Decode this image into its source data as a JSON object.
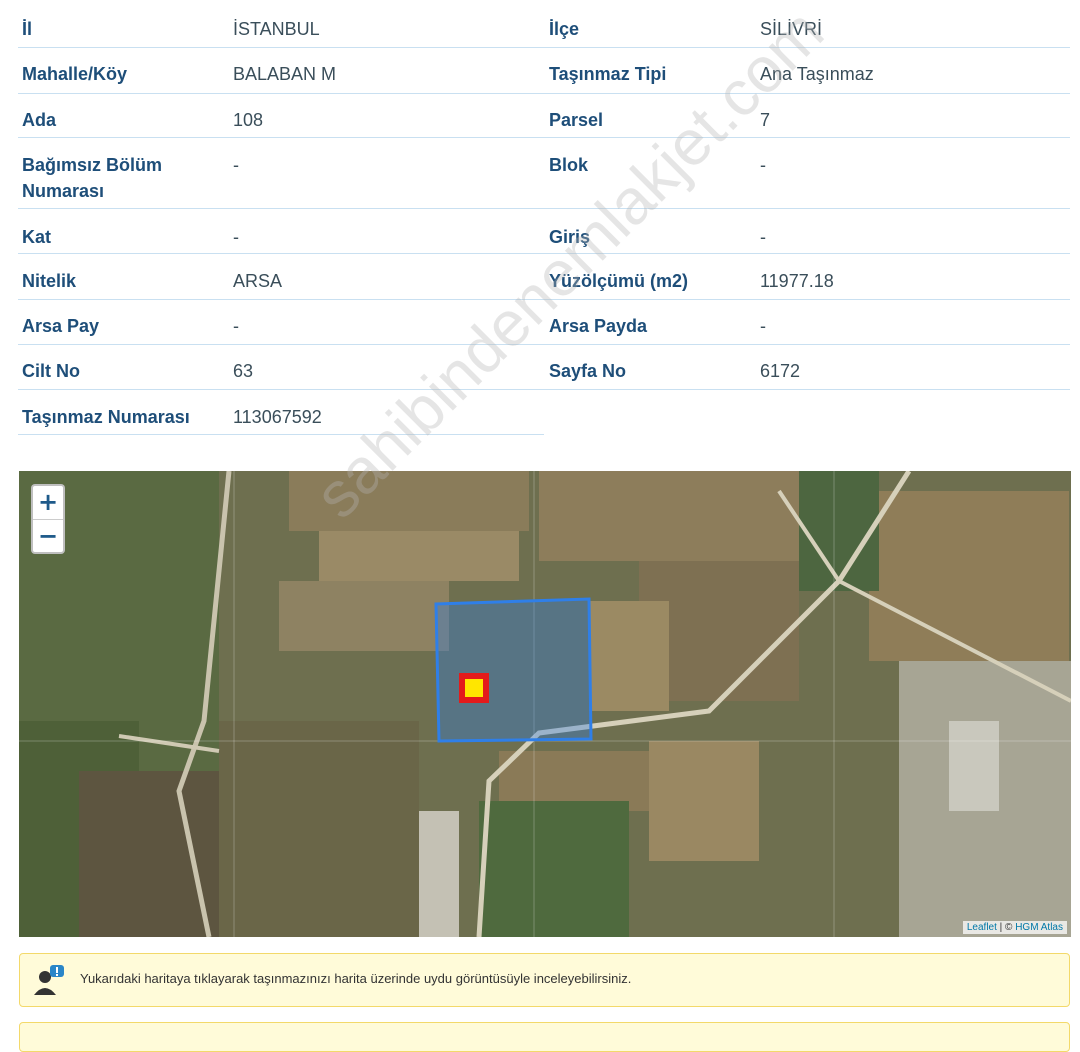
{
  "rows": [
    {
      "l1": "İl",
      "v1": "İSTANBUL",
      "l2": "İlçe",
      "v2": "SİLİVRİ"
    },
    {
      "l1": "Mahalle/Köy",
      "v1": "BALABAN M",
      "l2": "Taşınmaz Tipi",
      "v2": "Ana Taşınmaz"
    },
    {
      "l1": "Ada",
      "v1": "108",
      "l2": "Parsel",
      "v2": "7"
    },
    {
      "l1": "Bağımsız Bölüm",
      "l1b": "Numarası",
      "v1": "-",
      "l2": "Blok",
      "v2": "-"
    },
    {
      "l1": "Kat",
      "v1": "-",
      "l2": "Giriş",
      "v2": "-"
    },
    {
      "l1": "Nitelik",
      "v1": "ARSA",
      "l2": "Yüzölçümü (m2)",
      "v2": "11977.18"
    },
    {
      "l1": "Arsa Pay",
      "v1": "-",
      "l2": "Arsa Payda",
      "v2": "-"
    },
    {
      "l1": "Cilt No",
      "v1": "63",
      "l2": "Sayfa No",
      "v2": "6172"
    },
    {
      "l1": "Taşınmaz Numarası",
      "v1": "113067592"
    }
  ],
  "map": {
    "zoom_in": "+",
    "zoom_out": "−",
    "attribution_leaflet": "Leaflet",
    "attribution_sep": " | © ",
    "attribution_source": "HGM Atlas"
  },
  "watermark": "sahibindenemlakjet.com",
  "notice": {
    "text": "Yukarıdaki haritaya tıklayarak taşınmazınızı harita üzerinde uydu görüntüsüyle inceleyebilirsiniz."
  },
  "colors": {
    "label": "#1e4e79",
    "parcel_outline": "#2f7fe8",
    "marker_outer": "#e31b1b",
    "marker_inner": "#ffe600"
  }
}
